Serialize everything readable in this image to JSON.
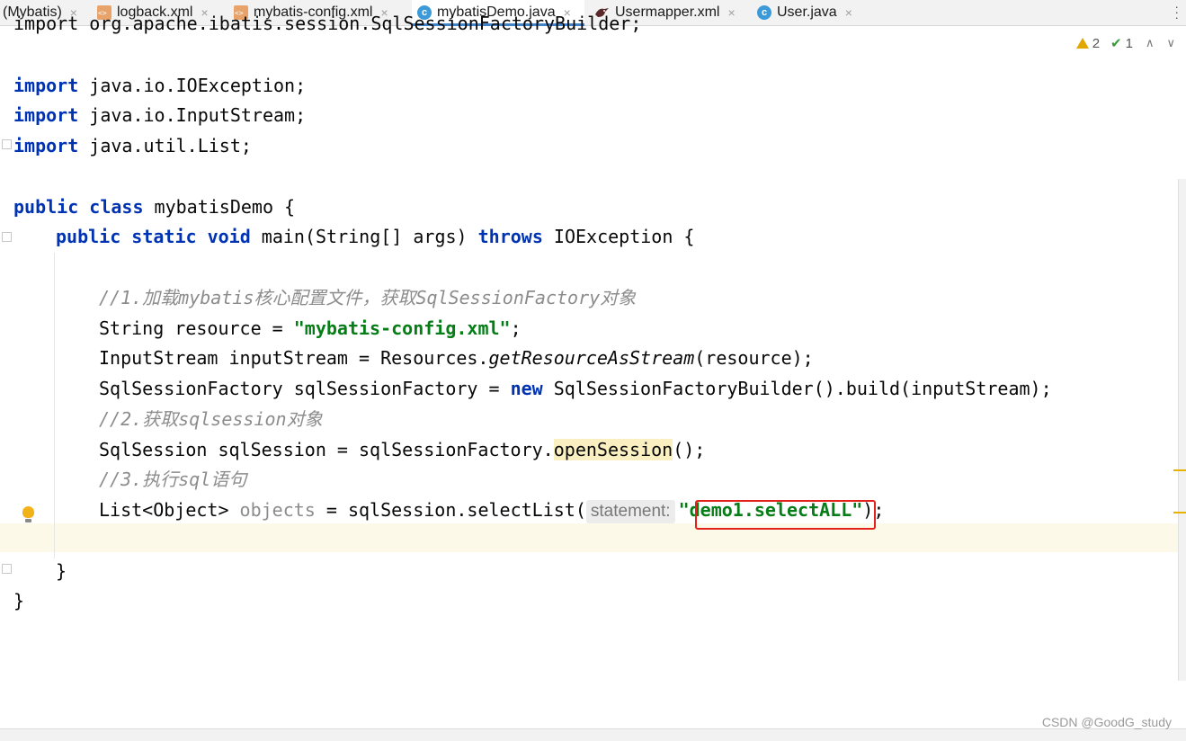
{
  "tabs": [
    {
      "label": "(Mybatis)",
      "icon": "none",
      "active": false
    },
    {
      "label": "logback.xml",
      "icon": "xml-file-icon",
      "active": false
    },
    {
      "label": "mybatis-config.xml",
      "icon": "xml-file-icon",
      "active": false
    },
    {
      "label": "mybatisDemo.java",
      "icon": "java-class-icon",
      "active": true
    },
    {
      "label": "Usermapper.xml",
      "icon": "mybatis-mapper-icon",
      "active": false
    },
    {
      "label": "User.java",
      "icon": "java-class-icon",
      "active": false
    }
  ],
  "tab_close_glyph": "×",
  "inspections": {
    "warnings": "2",
    "weak_warnings": "1"
  },
  "code": {
    "line0": "import org.apache.ibatis.session.SqlSessionFactoryBuilder;",
    "imp_kw": "import",
    "imp1": " java.io.IOException;",
    "imp2": " java.io.InputStream;",
    "imp3": " java.util.List;",
    "cls_kw": "public class",
    "cls_name": " mybatisDemo {",
    "main_kw1": "public static void",
    "main_sig": " main(String[] args) ",
    "main_kw2": "throws",
    "main_end": " IOException {",
    "c1": "//1.加载mybatis核心配置文件，获取SqlSessionFactory对象",
    "l_res_a": "String resource = ",
    "l_res_str": "\"mybatis-config.xml\"",
    "l_res_b": ";",
    "l_is_a": "InputStream inputStream = Resources.",
    "l_is_m": "getResourceAsStream",
    "l_is_b": "(resource);",
    "l_sf_a": "SqlSessionFactory sqlSessionFactory = ",
    "l_sf_kw": "new",
    "l_sf_b": " SqlSessionFactoryBuilder().build(inputStream);",
    "c2": "//2.获取sqlsession对象",
    "l_ss_a": "SqlSession sqlSession = sqlSessionFactory.",
    "l_ss_m": "openSession",
    "l_ss_b": "();",
    "c3": "//3.执行sql语句",
    "l_ls_a": "List<Object> ",
    "l_ls_var": "objects",
    "l_ls_b": " = sqlSession.selectList(",
    "l_ls_hint": "statement:",
    "l_ls_str": "\"demo1.selectALL\"",
    "l_ls_c": ");",
    "close1": "}",
    "close2": "}"
  },
  "watermark": "CSDN @GoodG_study",
  "colors": {
    "keyword": "#0033b3",
    "string": "#067d17",
    "comment": "#8c8c8c",
    "highlight_box": "#e3221b",
    "active_tab_underline": "#4083c9"
  }
}
